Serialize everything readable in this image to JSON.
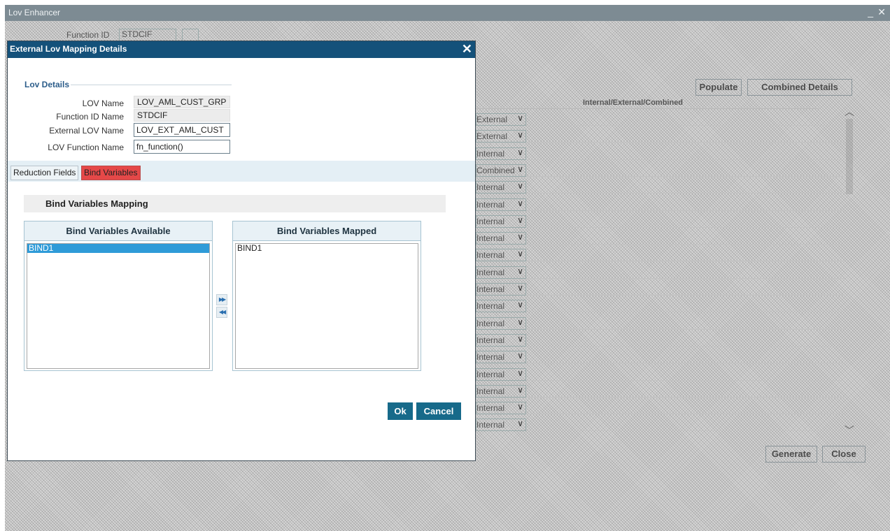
{
  "background": {
    "window_title": "Lov Enhancer",
    "minimize_glyph": "_",
    "close_glyph": "✕",
    "function_id_label": "Function ID",
    "function_id_value": "STDCIF",
    "populate_label": "Populate",
    "combined_details_label": "Combined Details",
    "column_header": "Internal/External/Combined",
    "generate_label": "Generate",
    "close_label": "Close",
    "row_types": [
      "External",
      "External",
      "Internal",
      "Combined",
      "Internal",
      "Internal",
      "Internal",
      "Internal",
      "Internal",
      "Internal",
      "Internal",
      "Internal",
      "Internal",
      "Internal",
      "Internal",
      "Internal",
      "Internal",
      "Internal",
      "Internal"
    ]
  },
  "dialog": {
    "title": "External Lov Mapping Details",
    "close_glyph": "✕",
    "lov_details": {
      "legend": "Lov Details",
      "lov_name_label": "LOV Name",
      "lov_name_value": "LOV_AML_CUST_GRP",
      "function_id_name_label": "Function ID Name",
      "function_id_name_value": "STDCIF",
      "external_lov_name_label": "External LOV Name",
      "external_lov_name_value": "LOV_EXT_AML_CUST",
      "lov_function_name_label": "LOV Function Name",
      "lov_function_name_value": "fn_function()"
    },
    "tabs": {
      "reduction_fields": "Reduction Fields",
      "bind_variables": "Bind Variables"
    },
    "bind_variables_mapping": {
      "title": "Bind Variables Mapping",
      "available_header": "Bind Variables Available",
      "available_items": [
        "BIND1"
      ],
      "mapped_header": "Bind Variables Mapped",
      "mapped_items": [
        "BIND1"
      ],
      "move_right_glyph": "▶▶",
      "move_left_glyph": "◀◀"
    },
    "ok_label": "Ok",
    "cancel_label": "Cancel"
  }
}
